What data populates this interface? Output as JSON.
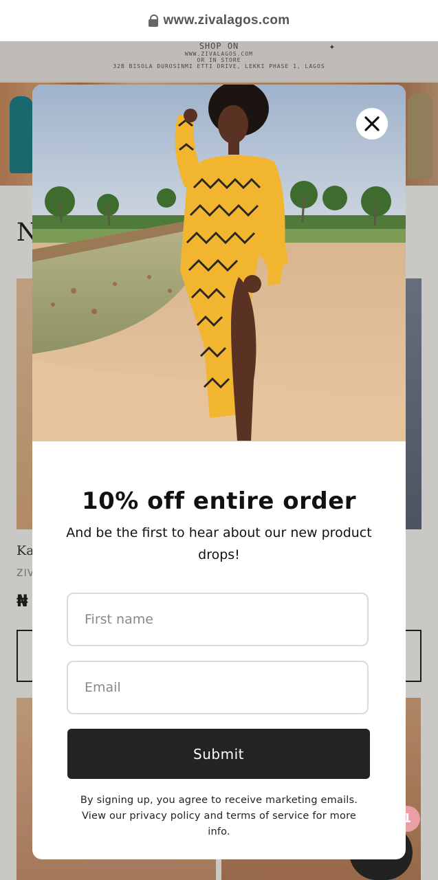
{
  "browser": {
    "url": "www.zivalagos.com",
    "lock_icon": "lock-icon"
  },
  "background_page": {
    "banner": {
      "line1": "SHOP ON",
      "line2": "WWW.ZIVALAGOS.COM",
      "line3": "OR IN STORE",
      "line4": "32B BISOLA DUROSINMI ETTI DRIVE, LEKKI PHASE 1, LAGOS"
    },
    "heading_fragment": "N",
    "product": {
      "name_fragment": "Ka",
      "brand_fragment": "ZIV",
      "price_fragment": "₦"
    },
    "chat_badge": "1"
  },
  "popup": {
    "close_icon": "close-icon",
    "headline": "10% off entire order",
    "subline": "And be the first to hear about our new product drops!",
    "first_name_placeholder": "First name",
    "email_placeholder": "Email",
    "submit_label": "Submit",
    "legal_text": "By signing up, you agree to receive marketing emails. View our privacy policy and terms of service for more info."
  },
  "colors": {
    "submit_bg": "#232324",
    "modal_bg": "#ffffff",
    "dress_yellow": "#f2b530"
  }
}
